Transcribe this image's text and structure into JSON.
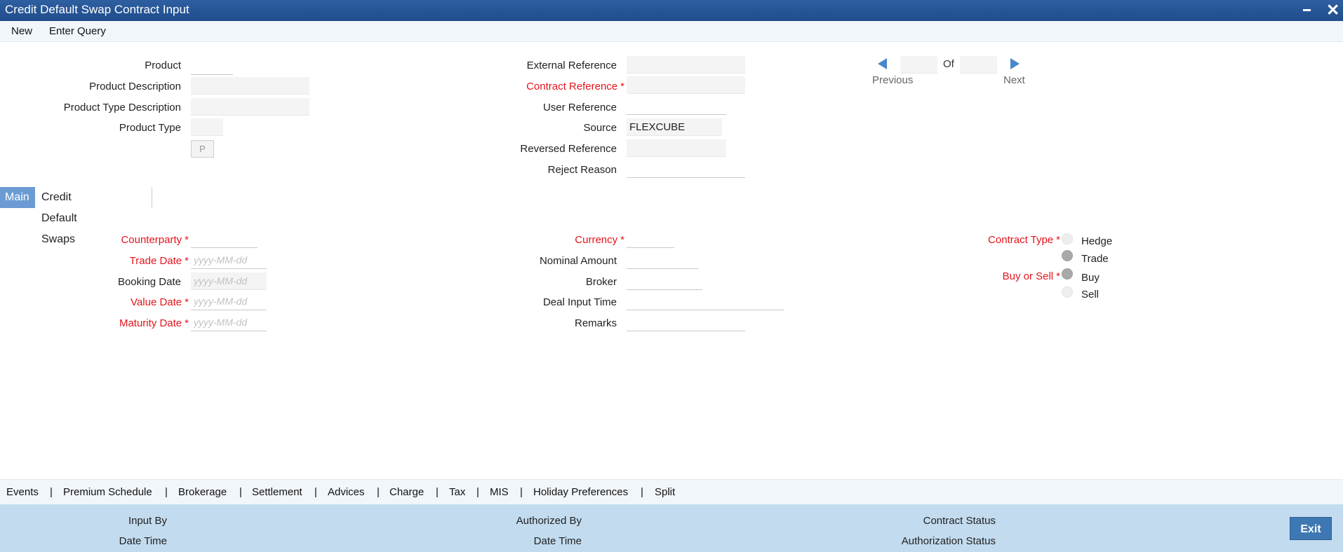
{
  "window": {
    "title": "Credit Default Swap Contract Input"
  },
  "toolbar": {
    "new_label": "New",
    "enter_query_label": "Enter Query"
  },
  "header": {
    "product_label": "Product",
    "product_description_label": "Product Description",
    "product_type_description_label": "Product Type Description",
    "product_type_label": "Product Type",
    "p_button": "P",
    "external_reference_label": "External Reference",
    "contract_reference_label": "Contract Reference",
    "user_reference_label": "User Reference",
    "source_label": "Source",
    "source_value": "FLEXCUBE",
    "reversed_reference_label": "Reversed Reference",
    "reject_reason_label": "Reject Reason",
    "of_label": "Of",
    "previous_label": "Previous",
    "next_label": "Next",
    "required_mark": "*"
  },
  "tabs": [
    {
      "label": "Main",
      "active": true
    },
    {
      "label": "Credit Default Swaps",
      "active": false
    }
  ],
  "main": {
    "counterparty_label": "Counterparty",
    "trade_date_label": "Trade Date",
    "booking_date_label": "Booking Date",
    "value_date_label": "Value Date",
    "maturity_date_label": "Maturity Date",
    "date_placeholder": "yyyy-MM-dd",
    "currency_label": "Currency",
    "nominal_amount_label": "Nominal Amount",
    "broker_label": "Broker",
    "deal_input_time_label": "Deal Input Time",
    "remarks_label": "Remarks",
    "contract_type_label": "Contract Type",
    "contract_type_options": [
      "Hedge",
      "Trade"
    ],
    "contract_type_selected": "Trade",
    "buy_or_sell_label": "Buy or Sell",
    "buy_or_sell_options": [
      "Buy",
      "Sell"
    ],
    "buy_or_sell_selected": "Buy"
  },
  "bottom_links": [
    "Events",
    "Premium Schedule",
    "Brokerage",
    "Settlement",
    "Advices",
    "Charge",
    "Tax",
    "MIS",
    "Holiday Preferences",
    "Split"
  ],
  "bottom_separator": "|",
  "footer": {
    "input_by_label": "Input By",
    "date_time_label": "Date Time",
    "authorized_by_label": "Authorized By",
    "contract_status_label": "Contract Status",
    "authorization_status_label": "Authorization Status",
    "exit_label": "Exit"
  },
  "colors": {
    "title_bar": "#1f4c8c",
    "required": "#e4141c",
    "footer": "#c2dbef",
    "active_tab": "#6b9bd2",
    "exit_button": "#3e78b3"
  }
}
